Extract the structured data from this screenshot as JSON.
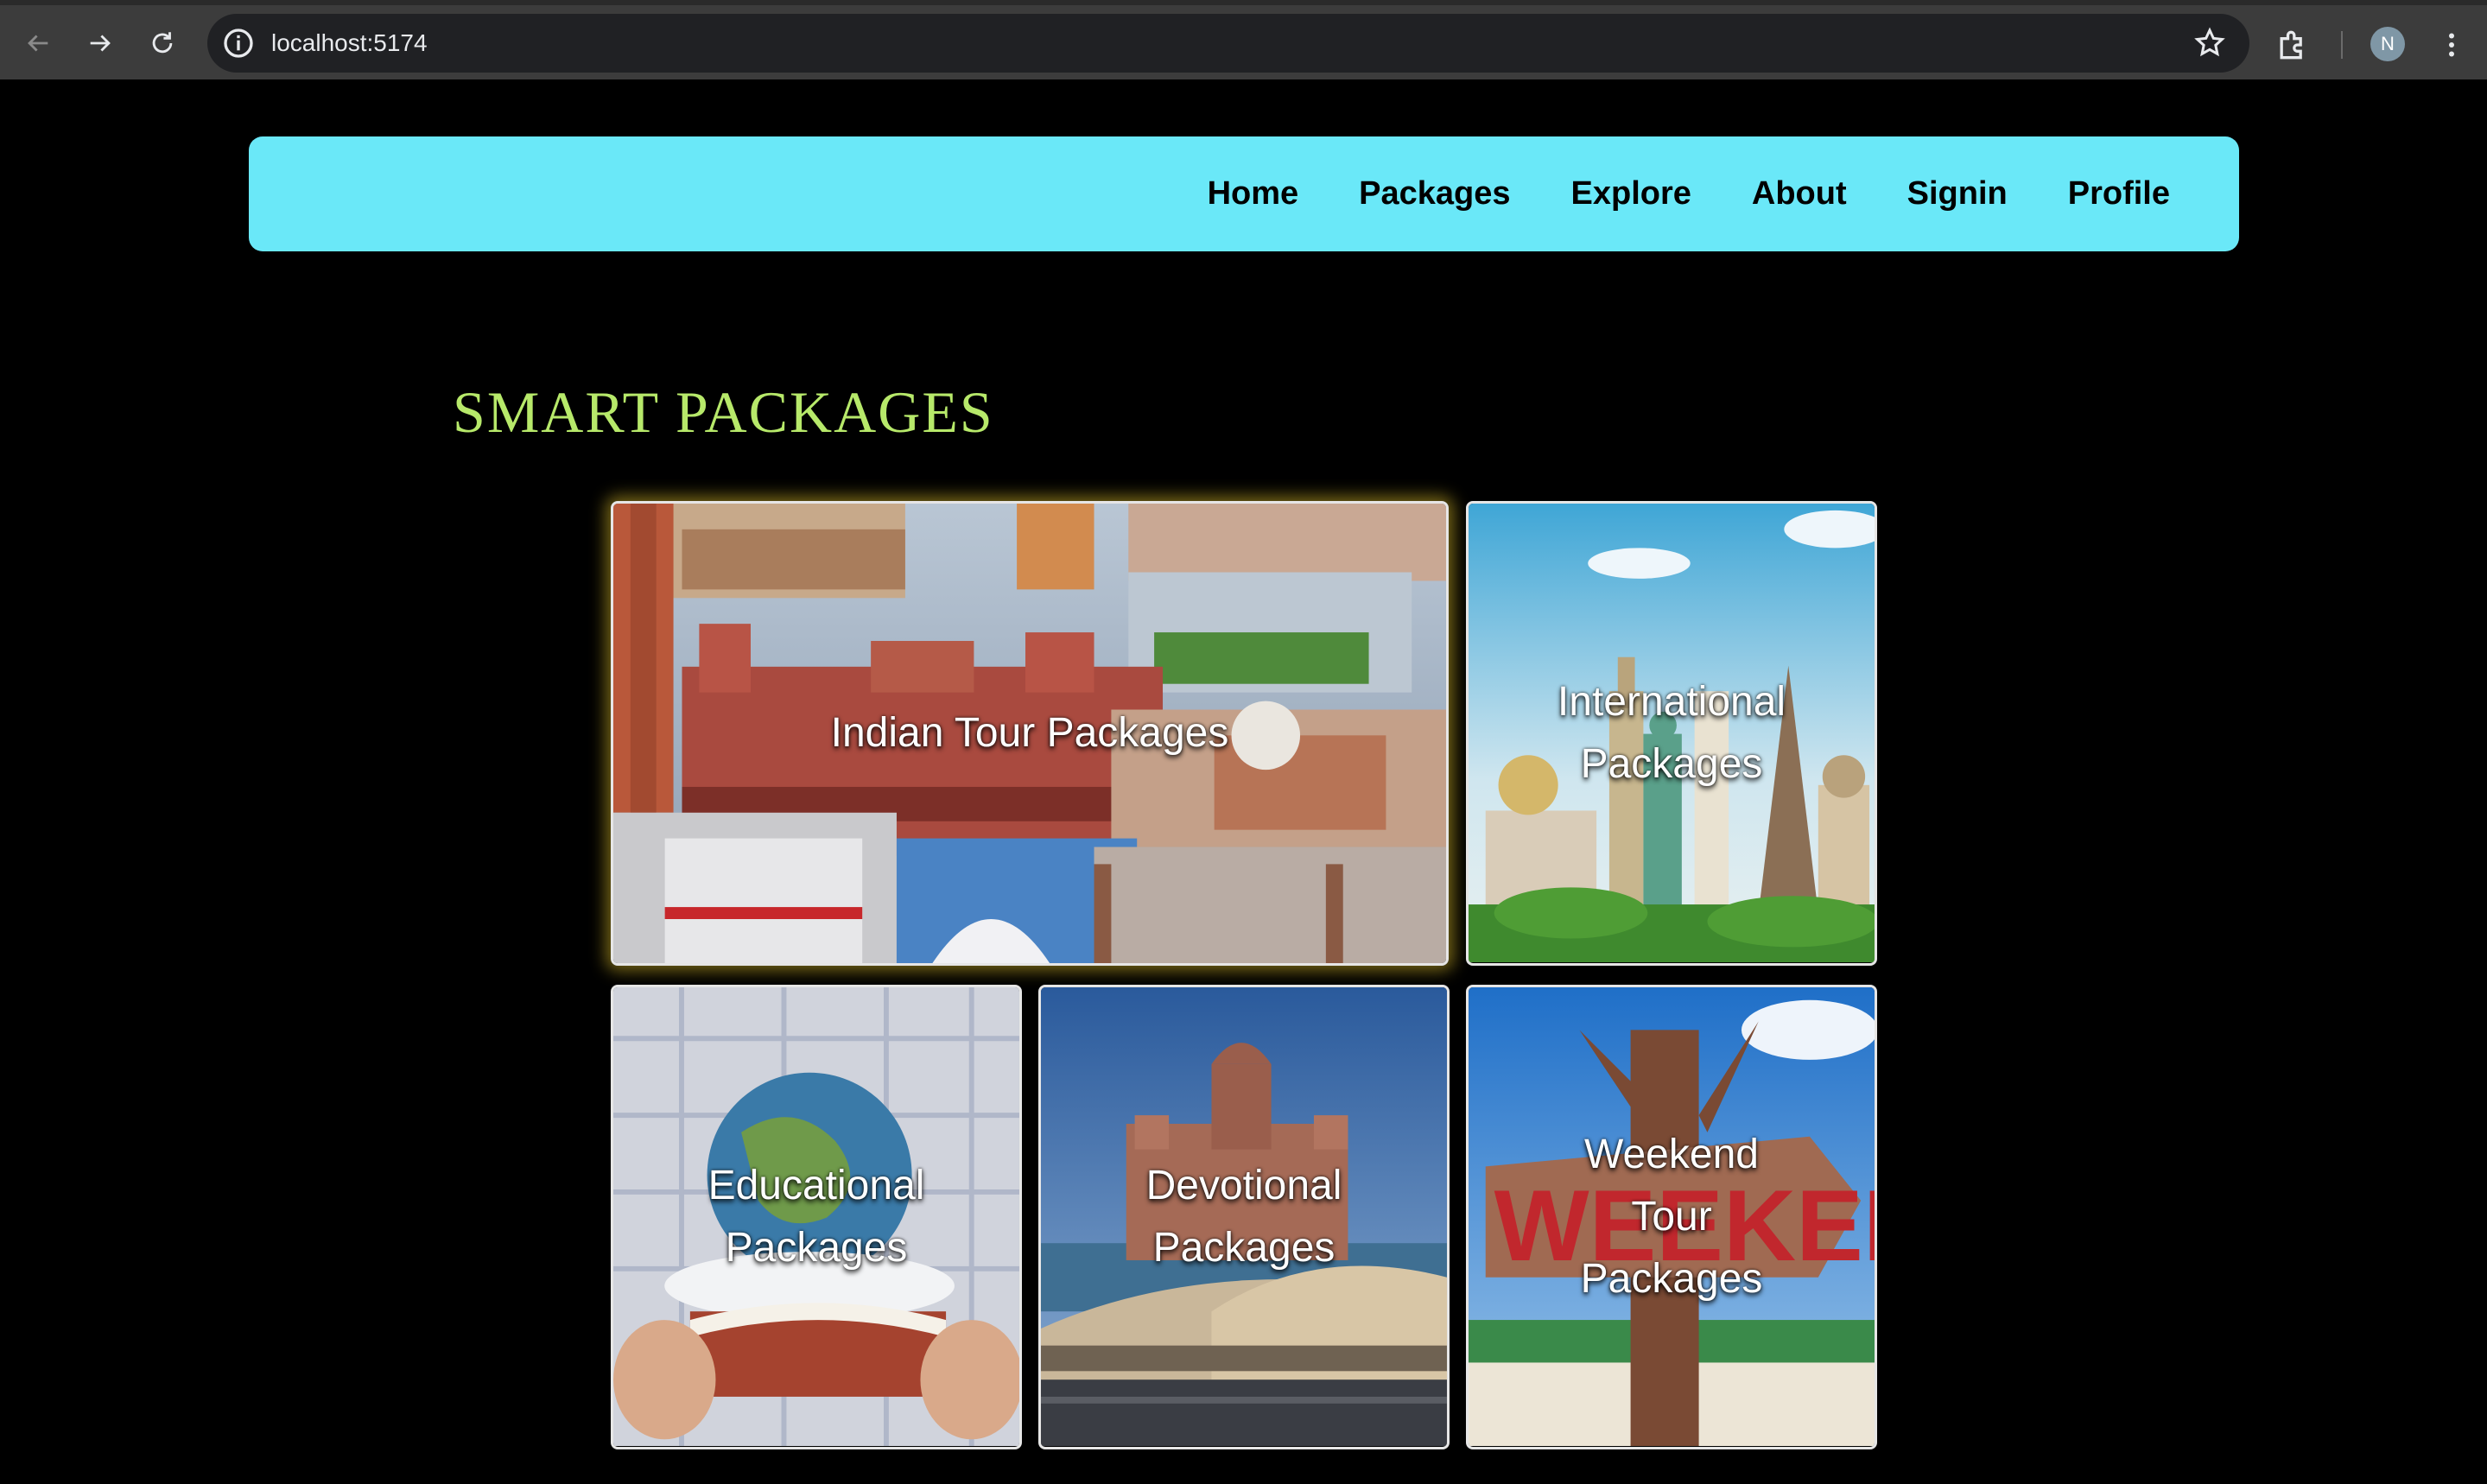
{
  "browser": {
    "url": "localhost:5174",
    "profile_initial": "N"
  },
  "navbar": {
    "links": [
      "Home",
      "Packages",
      "Explore",
      "About",
      "Signin",
      "Profile"
    ]
  },
  "section": {
    "title": "SMART PACKAGES"
  },
  "packages": [
    {
      "label": "Indian Tour Packages"
    },
    {
      "label": "International Packages"
    },
    {
      "label": "Educational Packages"
    },
    {
      "label": "Devotional Packages"
    },
    {
      "label": "Weekend Tour Packages"
    }
  ],
  "images": {
    "weekend_sign_text": "WEEKEND"
  }
}
